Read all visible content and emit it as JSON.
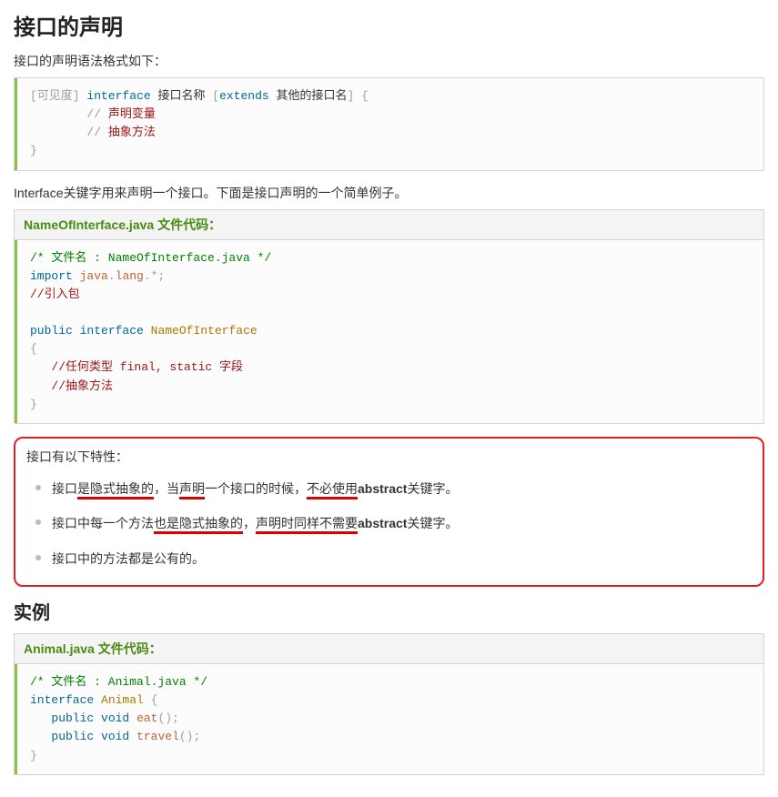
{
  "title": "接口的声明",
  "intro1": "接口的声明语法格式如下：",
  "code1": {
    "visibility": "[可见度]",
    "kw_interface": "interface",
    "text_ifname": "接口名称",
    "extends_open": "[",
    "kw_extends": "extends",
    "text_other": "其他的接口名",
    "extends_close": "]",
    "brace_open": "{",
    "comment_prefix1": "// ",
    "comment_var": "声明变量",
    "comment_prefix2": "// ",
    "comment_method": "抽象方法",
    "brace_close": "}"
  },
  "intro2": "Interface关键字用来声明一个接口。下面是接口声明的一个简单例子。",
  "code2": {
    "header": "NameOfInterface.java 文件代码：",
    "c1": "/* 文件名 : NameOfInterface.java */",
    "kw_import": "import",
    "pkg1": "java",
    "dot": ".",
    "pkg2": "lang",
    "star": ".*;",
    "c2": "//引入包",
    "kw_public": "public",
    "kw_interface": "interface",
    "classname": "NameOfInterface",
    "brace_open": "{",
    "c3": "//任何类型 final, static 字段",
    "c4": "//抽象方法",
    "brace_close": "}"
  },
  "features": {
    "intro": "接口有以下特性：",
    "item1": {
      "p1": "接口",
      "u1": "是隐式抽象的",
      "p2": "，当",
      "u2": "声明",
      "p3": "一个接口的时候，",
      "u3": "不必使用",
      "b1": "abstract",
      "p4": "关键字。"
    },
    "item2": {
      "p1": "接口中每一个方法",
      "u1": "也是隐式抽象的",
      "p2": "，",
      "u2": "声明时同样不需要",
      "b1": "abstract",
      "p3": "关键字。"
    },
    "item3": "接口中的方法都是公有的。"
  },
  "example_title": "实例",
  "code3": {
    "header": "Animal.java 文件代码：",
    "c1": "/* 文件名 : Animal.java */",
    "kw_interface": "interface",
    "classname": "Animal",
    "brace_open": "{",
    "kw_public1": "public",
    "kw_void1": "void",
    "fn_eat": "eat",
    "paren1": "();",
    "kw_public2": "public",
    "kw_void2": "void",
    "fn_travel": "travel",
    "paren2": "();",
    "brace_close": "}"
  }
}
